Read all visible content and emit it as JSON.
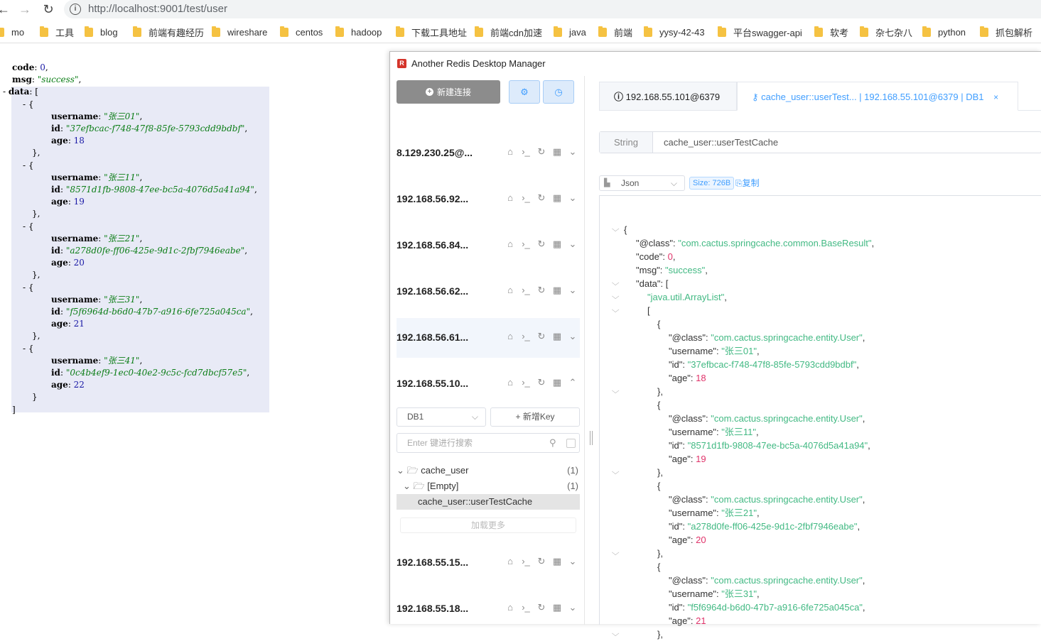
{
  "browser": {
    "url": "http://localhost:9001/test/user",
    "bookmarks": [
      "mo",
      "工具",
      "blog",
      "前端有趣经历",
      "wireshare",
      "centos",
      "hadoop",
      "下载工具地址",
      "前端cdn加速",
      "java",
      "前端",
      "yysy-42-43",
      "平台swagger-api",
      "软考",
      "杂七杂八",
      "python",
      "抓包解析"
    ]
  },
  "json_view": {
    "code": "0",
    "msg": "\"success\"",
    "users": [
      {
        "username": "\"张三01\"",
        "id": "\"37efbcac-f748-47f8-85fe-5793cdd9bdbf\"",
        "age": "18"
      },
      {
        "username": "\"张三11\"",
        "id": "\"8571d1fb-9808-47ee-bc5a-4076d5a41a94\"",
        "age": "19"
      },
      {
        "username": "\"张三21\"",
        "id": "\"a278d0fe-ff06-425e-9d1c-2fbf7946eabe\"",
        "age": "20"
      },
      {
        "username": "\"张三31\"",
        "id": "\"f5f6964d-b6d0-47b7-a916-6fe725a045ca\"",
        "age": "21"
      },
      {
        "username": "\"张三41\"",
        "id": "\"0c4b4ef9-1ec0-40e2-9c5c-fcd7dbcf57e5\"",
        "age": "22"
      }
    ]
  },
  "rdm": {
    "title": "Another Redis Desktop Manager",
    "new_conn": "新建连接",
    "connections": [
      "8.129.230.25@...",
      "192.168.56.92...",
      "192.168.56.84...",
      "192.168.56.62...",
      "192.168.56.61...",
      "192.168.55.10...",
      "192.168.55.15...",
      "192.168.55.18..."
    ],
    "db": "DB1",
    "add_key": "+ 新增Key",
    "search_placeholder": "Enter 键进行搜索",
    "tree": [
      {
        "label": "cache_user",
        "count": "(1)"
      },
      {
        "label": "[Empty]",
        "count": "(1)"
      },
      {
        "label": "cache_user::userTestCache",
        "count": ""
      }
    ],
    "load_more": "加载更多",
    "tab_conn": "192.168.55.101@6379",
    "tab_key": "cache_user::userTest... | 192.168.55.101@6379 | DB1",
    "type": "String",
    "key": "cache_user::userTestCache",
    "format": "Json",
    "size": "Size: 726B",
    "copy": "复制",
    "value": {
      "class_base": "\"com.cactus.springcache.common.BaseResult\"",
      "code": "0",
      "msg": "\"success\"",
      "list_class": "\"java.util.ArrayList\"",
      "user_class": "\"com.cactus.springcache.entity.User\"",
      "users": [
        {
          "username": "\"张三01\"",
          "id": "\"37efbcac-f748-47f8-85fe-5793cdd9bdbf\"",
          "age": "18"
        },
        {
          "username": "\"张三11\"",
          "id": "\"8571d1fb-9808-47ee-bc5a-4076d5a41a94\"",
          "age": "19"
        },
        {
          "username": "\"张三21\"",
          "id": "\"a278d0fe-ff06-425e-9d1c-2fbf7946eabe\"",
          "age": "20"
        },
        {
          "username": "\"张三31\"",
          "id": "\"f5f6964d-b6d0-47b7-a916-6fe725a045ca\"",
          "age": "21"
        }
      ]
    }
  }
}
